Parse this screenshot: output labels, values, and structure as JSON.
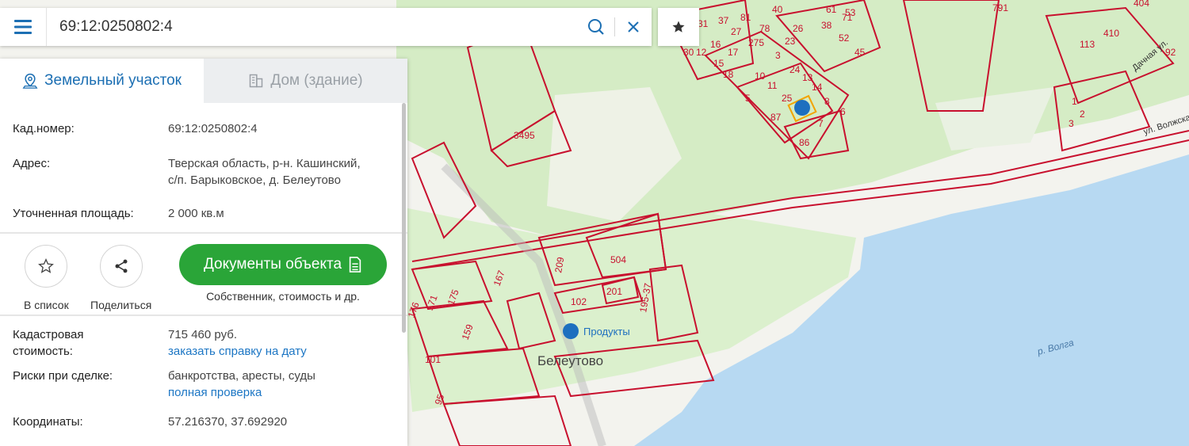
{
  "search": {
    "query": "69:12:0250802:4"
  },
  "icons": {
    "menu": "menu-icon",
    "search": "search-icon",
    "clear": "close-icon",
    "favorite": "star-icon"
  },
  "colors": {
    "accent": "#1c76c4",
    "green": "#2aa538",
    "parcel": "#c8102e",
    "water": "#b7d9f2",
    "forest": "#d3ecc4"
  },
  "tabs": [
    {
      "label": "Земельный участок",
      "active": true
    },
    {
      "label": "Дом (здание)",
      "active": false
    }
  ],
  "info": {
    "cad_label": "Кад.номер:",
    "cad_value": "69:12:0250802:4",
    "addr_label": "Адрес:",
    "addr_line1": "Тверская область, р-н. Кашинский,",
    "addr_line2": "с/п. Барыковское, д. Белеутово",
    "area_label": "Уточненная площадь:",
    "area_value": "2 000 кв.м"
  },
  "actions": {
    "list_label": "В список",
    "share_label": "Поделиться",
    "docs_label": "Документы объекта",
    "docs_caption": "Собственник, стоимость и др."
  },
  "details": {
    "cost_label_1": "Кадастровая",
    "cost_label_2": "стоимость:",
    "cost_value": "715 460 руб.",
    "cost_link": "заказать справку на дату",
    "risk_label": "Риски при сделке:",
    "risk_value": "банкротства, аресты, суды",
    "risk_link": "полная проверка",
    "coords_label": "Координаты:",
    "coords_value": "57.216370, 37.692920"
  },
  "map": {
    "village": "Белеутово",
    "river": "р. Волга",
    "shop": "Продукты",
    "street": "ул. Волжская",
    "street2": "Дачная ул.",
    "parcels": [
      "3495",
      "504",
      "209",
      "102",
      "201",
      "195-37",
      "167",
      "176",
      "171",
      "175",
      "159",
      "101",
      "95",
      "86",
      "87",
      "7",
      "8",
      "6",
      "25",
      "14",
      "13",
      "24",
      "23",
      "11",
      "10",
      "5",
      "3",
      "26",
      "38",
      "52",
      "45",
      "61",
      "71",
      "53",
      "40",
      "37",
      "81",
      "78",
      "27",
      "275",
      "16",
      "15",
      "12",
      "17",
      "18",
      "30",
      "31",
      "791",
      "404",
      "410",
      "113",
      "92",
      "1",
      "2",
      "3"
    ]
  }
}
